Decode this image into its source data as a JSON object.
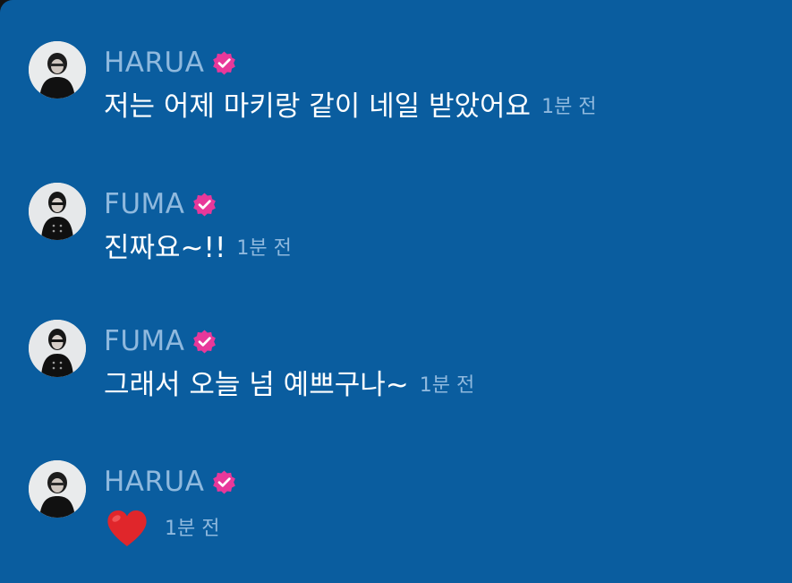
{
  "messages": [
    {
      "author": "HARUA",
      "text": "저는 어제 마키랑 같이 네일 받았어요",
      "time": "1분 전",
      "verified": true
    },
    {
      "author": "FUMA",
      "text": "진짜요~!!",
      "time": "1분 전",
      "verified": true
    },
    {
      "author": "FUMA",
      "text": "그래서 오늘 넘 예쁘구나~",
      "time": "1분 전",
      "verified": true
    },
    {
      "author": "HARUA",
      "text": "",
      "reaction": "heart-emoji",
      "time": "1분 전",
      "verified": true
    }
  ],
  "colors": {
    "background": "#0a5d9f",
    "name": "#8fb9de",
    "time": "#8fb9de",
    "message_text": "#ffffff",
    "verified_badge": "#e8389a",
    "heart": "#e0262b"
  }
}
